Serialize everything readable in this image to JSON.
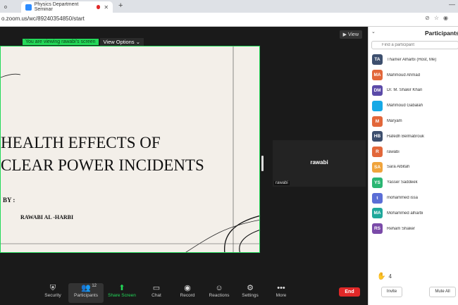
{
  "browser": {
    "inactive_tab": "o",
    "active_tab": "Physics Department Seminar",
    "new_tab": "+",
    "url": "o.zoom.us/wc/89240354850/start"
  },
  "meeting": {
    "view_label": "View",
    "viewing_text": "You are viewing rawabi's screen",
    "view_options": "View Options",
    "slide": {
      "title_line1": "HEALTH EFFECTS OF",
      "title_line2": "CLEAR POWER INCIDENTS",
      "by": "BY :",
      "author": "RAWABI AL -HARBI"
    },
    "thumbnail": {
      "name": "rawabi",
      "label": "rawabi"
    }
  },
  "toolbar": {
    "items": [
      {
        "label": "Security",
        "icon": "shield-icon"
      },
      {
        "label": "Participants",
        "icon": "people-icon",
        "count": "12"
      },
      {
        "label": "Share Screen",
        "icon": "share-screen-icon"
      },
      {
        "label": "Chat",
        "icon": "chat-icon"
      },
      {
        "label": "Record",
        "icon": "record-icon"
      },
      {
        "label": "Reactions",
        "icon": "reactions-icon"
      },
      {
        "label": "Settings",
        "icon": "gear-icon"
      },
      {
        "label": "More",
        "icon": "more-icon"
      }
    ],
    "end_label": "End",
    "end_color": "#e02828"
  },
  "participants_panel": {
    "title": "Participants",
    "search_placeholder": "Find a participant",
    "participants": [
      {
        "initials": "TA",
        "name": "Thamer Alharbi (Host, Me)",
        "color": "#3d4f6e"
      },
      {
        "initials": "MA",
        "name": "Mahmoud Ahmad",
        "color": "#e2673a"
      },
      {
        "initials": "DM",
        "name": "Dr. M. Shakir Khan",
        "color": "#5b4aa8"
      },
      {
        "initials": "",
        "name": "Mahmoud Gabalah",
        "color": "#16a9e6"
      },
      {
        "initials": "M",
        "name": "Maryam",
        "color": "#e2673a"
      },
      {
        "initials": "HB",
        "name": "Hafedh Belmabrouk",
        "color": "#3d4f6e"
      },
      {
        "initials": "R",
        "name": "rawabi",
        "color": "#e2673a"
      },
      {
        "initials": "SA",
        "name": "Sara Albitah",
        "color": "#f0a43c"
      },
      {
        "initials": "YS",
        "name": "Yasser Saddeek",
        "color": "#2bb673"
      },
      {
        "initials": "t",
        "name": "mohammed issa",
        "color": "#5b6ed6"
      },
      {
        "initials": "MA",
        "name": "Mohammed alharbi",
        "color": "#1fa89b"
      },
      {
        "initials": "RS",
        "name": "Reham Shaker",
        "color": "#7a4aa8"
      }
    ],
    "raised_hands": "4",
    "invite_label": "Invite",
    "mute_all_label": "Mute All"
  },
  "colors": {
    "share_border": "#23d959",
    "zoom_blue": "#2d8cff"
  }
}
